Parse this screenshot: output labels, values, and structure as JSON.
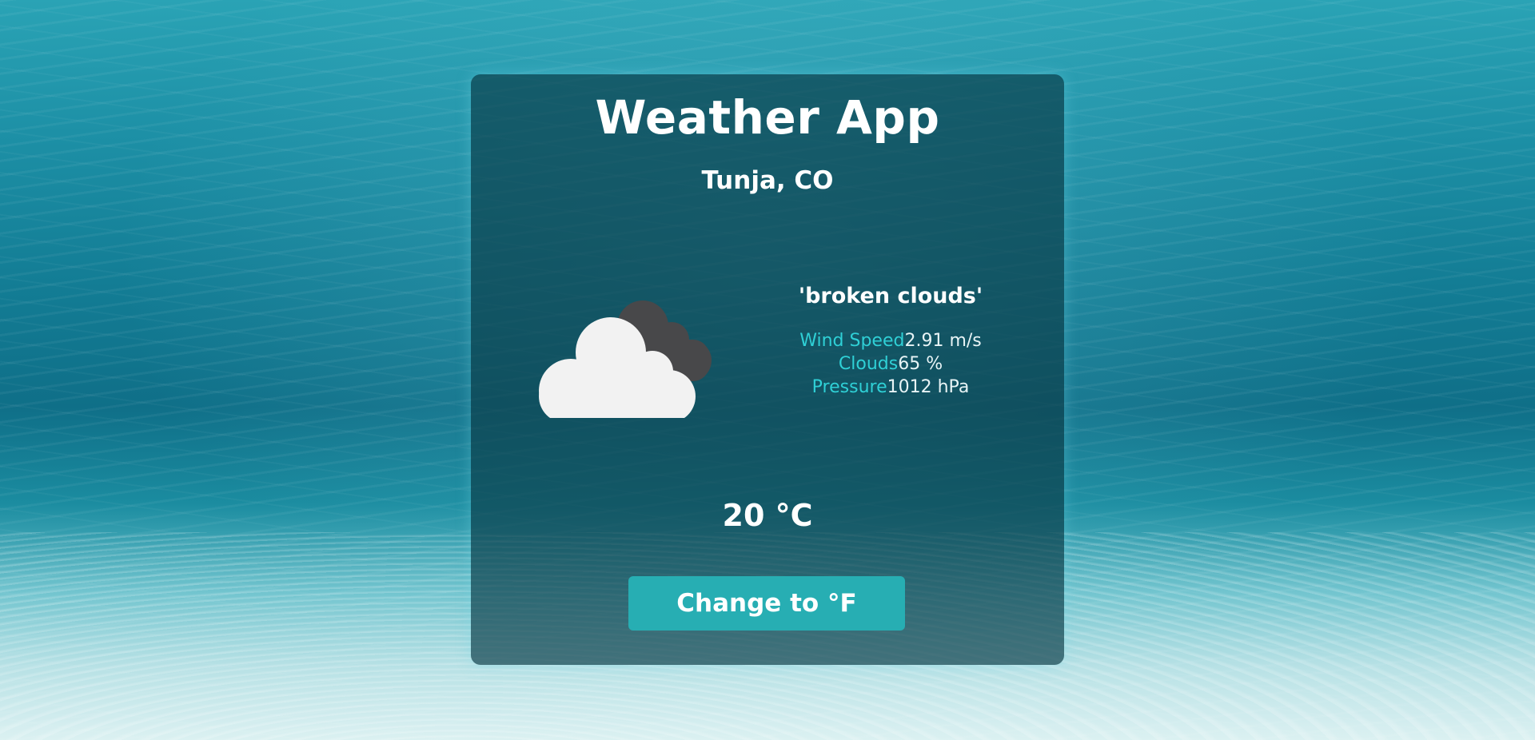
{
  "app": {
    "title": "Weather App"
  },
  "location": {
    "name": "Tunja, CO"
  },
  "weather": {
    "icon": "broken-clouds-icon",
    "description": "'broken clouds'",
    "stats": [
      {
        "label": "Wind Speed",
        "value": "2.91 m/s"
      },
      {
        "label": "Clouds",
        "value": "65 %"
      },
      {
        "label": "Pressure",
        "value": "1012 hPa"
      }
    ],
    "temperature": "20 °C"
  },
  "controls": {
    "unit_toggle_label": "Change to °F"
  },
  "colors": {
    "accent": "#27aeb3",
    "label": "#2fd0d6",
    "card_background": "#0a3c48",
    "cloud_light": "#f2f2f2",
    "cloud_dark": "#48484a"
  }
}
